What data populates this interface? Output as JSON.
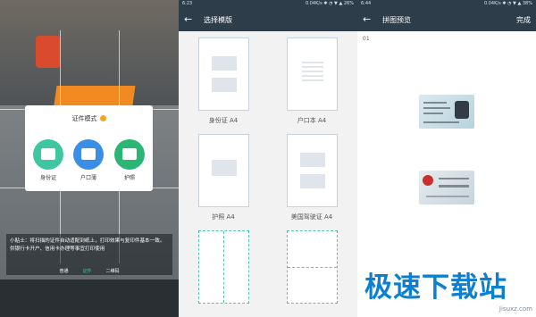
{
  "panel1": {
    "modal": {
      "title": "证件模式",
      "options": [
        {
          "label": "身份证",
          "color": "#3ec6a0"
        },
        {
          "label": "户口薄",
          "color": "#3b8ee5"
        },
        {
          "label": "护照",
          "color": "#2bb673"
        }
      ]
    },
    "tip": "小贴士：将扫描的证件自动适配到纸上，打印效果与复印件基本一致。供银行卡开户、信用卡办理等事宜打印使用",
    "bottom_nav": [
      {
        "label": "普通",
        "active": false
      },
      {
        "label": "证件",
        "active": true
      },
      {
        "label": "二维码",
        "active": false
      }
    ]
  },
  "panel2": {
    "status_time": "6:23",
    "status_right": "0.04K/s ✱ ◔ ▼ ▲ 26%",
    "title": "选择模版",
    "templates": [
      {
        "label": "身份证 A4"
      },
      {
        "label": "户口本 A4"
      },
      {
        "label": "护照 A4"
      },
      {
        "label": "美国驾驶证 A4"
      }
    ]
  },
  "panel3": {
    "status_time": "6:44",
    "status_right": "0.04K/s ✱ ◔ ▼ ▲ 38%",
    "title": "拼图预览",
    "done_label": "完成",
    "page_number": "01"
  },
  "watermark": {
    "text": "极速下载站",
    "sub": "Jisuxz.com"
  }
}
